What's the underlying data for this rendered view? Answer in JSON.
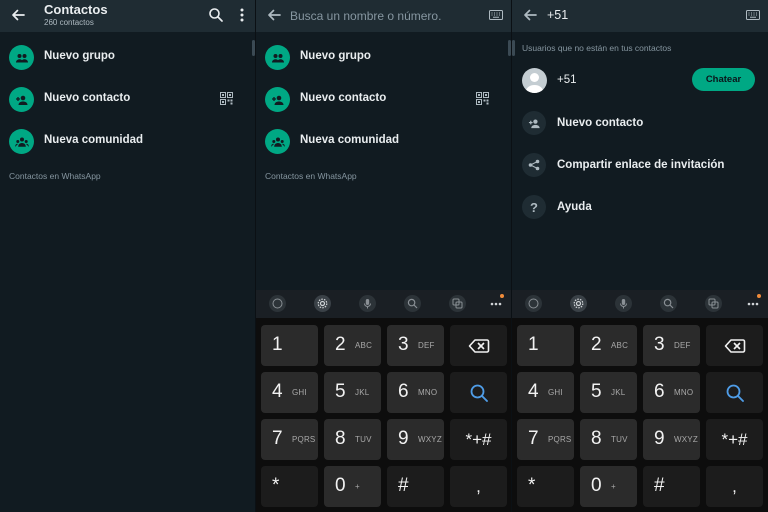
{
  "colors": {
    "accent": "#00a884",
    "background": "#111b21",
    "header": "#1f2c33",
    "search_key": "#4f9de8",
    "dot": "#f08b3a"
  },
  "panel1": {
    "title": "Contactos",
    "subtitle": "260 contactos",
    "items": [
      {
        "label": "Nuevo grupo",
        "icon": "group-icon"
      },
      {
        "label": "Nuevo contacto",
        "icon": "add-person-icon"
      },
      {
        "label": "Nueva comunidad",
        "icon": "community-icon"
      }
    ],
    "section": "Contactos en WhatsApp"
  },
  "panel2": {
    "search_placeholder": "Busca un nombre o número.",
    "items": [
      {
        "label": "Nuevo grupo",
        "icon": "group-icon"
      },
      {
        "label": "Nuevo contacto",
        "icon": "add-person-icon"
      },
      {
        "label": "Nueva comunidad",
        "icon": "community-icon"
      }
    ],
    "section": "Contactos en WhatsApp"
  },
  "panel3": {
    "search_value": "+51",
    "section": "Usuarios que no están en tus contactos",
    "result_number": "+51",
    "chat_button": "Chatear",
    "actions": [
      {
        "label": "Nuevo contacto",
        "icon": "add-person-icon"
      },
      {
        "label": "Compartir enlace de invitación",
        "icon": "share-icon"
      },
      {
        "label": "Ayuda",
        "icon": "help-icon"
      }
    ]
  },
  "keyboard": {
    "keys": [
      {
        "num": "1",
        "letters": ""
      },
      {
        "num": "2",
        "letters": "ABC"
      },
      {
        "num": "3",
        "letters": "DEF"
      },
      {
        "num": "4",
        "letters": "GHI"
      },
      {
        "num": "5",
        "letters": "JKL"
      },
      {
        "num": "6",
        "letters": "MNO"
      },
      {
        "num": "7",
        "letters": "PQRS"
      },
      {
        "num": "8",
        "letters": "TUV"
      },
      {
        "num": "9",
        "letters": "WXYZ"
      },
      {
        "num": "*",
        "letters": ""
      },
      {
        "num": "0",
        "letters": "+"
      },
      {
        "num": "#",
        "letters": ""
      }
    ],
    "symbols_key": "*+#",
    "comma_key": ",",
    "toolbar_icons": [
      "emoji-icon",
      "settings-icon",
      "mic-icon",
      "search-icon",
      "translate-icon",
      "more-icon"
    ]
  }
}
